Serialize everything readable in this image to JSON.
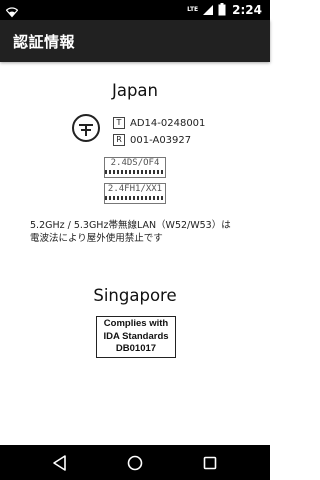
{
  "status_bar": {
    "network": "LTE",
    "time": "2:24"
  },
  "toolbar": {
    "title": "認証情報"
  },
  "japan": {
    "title": "Japan",
    "certs": [
      {
        "badge": "T",
        "value": "AD14-0248001"
      },
      {
        "badge": "R",
        "value": "001-A03927"
      }
    ],
    "freq_labels": [
      "2.4DS/OF4",
      "2.4FH1/XX1"
    ],
    "notice_line1": "5.2GHz / 5.3GHz帯無線LAN（W52/W53）は",
    "notice_line2": "電波法により屋外使用禁止です"
  },
  "singapore": {
    "title": "Singapore",
    "ida_lines": [
      "Complies with",
      "IDA Standards",
      "DB01017"
    ]
  },
  "colors": {
    "toolbar": "#212121",
    "status_bar": "#000000",
    "nav_bar": "#000000",
    "background": "#ffffff"
  },
  "icons": {
    "wifi": "wifi-icon",
    "signal": "signal-icon",
    "battery": "battery-icon",
    "back": "back-triangle-icon",
    "home": "home-circle-icon",
    "recents": "recents-square-icon"
  }
}
